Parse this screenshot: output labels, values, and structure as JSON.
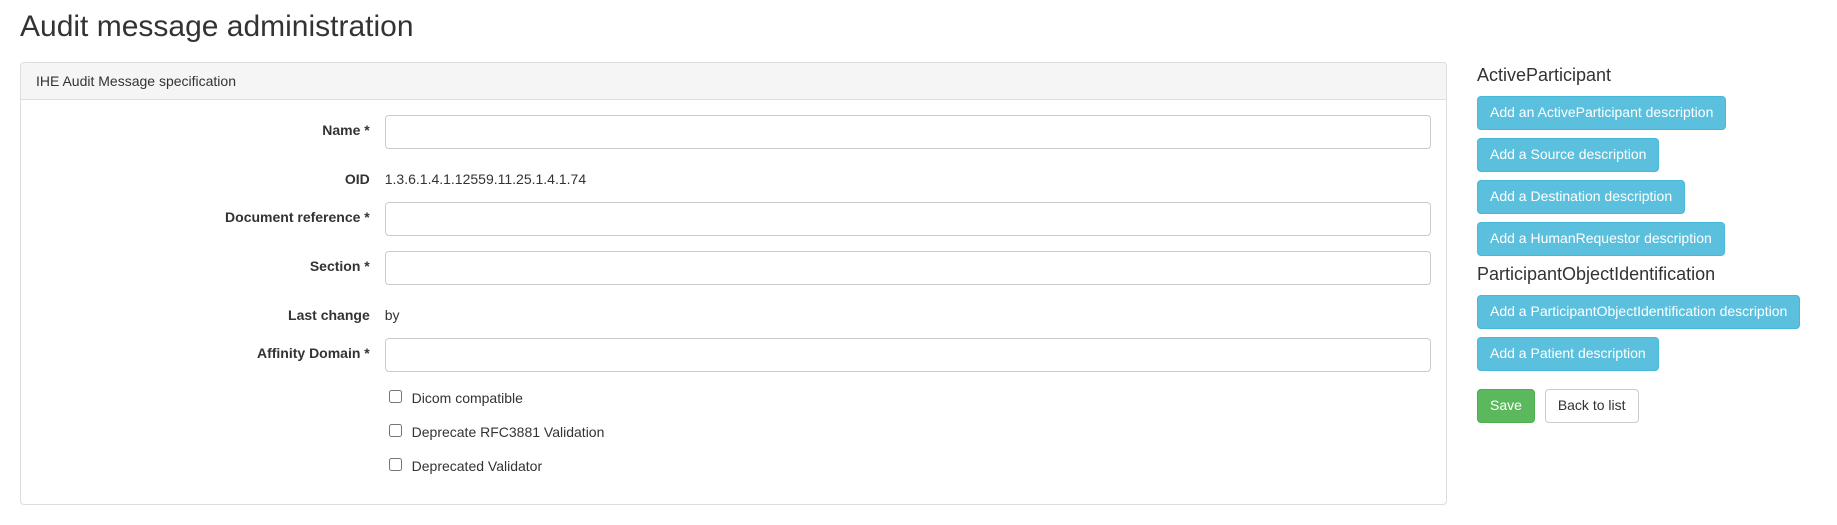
{
  "page_title": "Audit message administration",
  "panel": {
    "heading": "IHE Audit Message specification"
  },
  "form": {
    "labels": {
      "name": "Name *",
      "oid": "OID",
      "doc_ref": "Document reference *",
      "section": "Section *",
      "last_change": "Last change",
      "affinity": "Affinity Domain *"
    },
    "values": {
      "name": "",
      "oid": "1.3.6.1.4.1.12559.11.25.1.4.1.74",
      "doc_ref": "",
      "section": "",
      "last_change": "by",
      "affinity": ""
    },
    "checkboxes": {
      "dicom": {
        "label": "Dicom compatible",
        "checked": false
      },
      "deprecate_rfc": {
        "label": "Deprecate RFC3881 Validation",
        "checked": false
      },
      "deprecated_validator": {
        "label": "Deprecated Validator",
        "checked": false
      }
    }
  },
  "sidebar": {
    "active_participant": {
      "heading": "ActiveParticipant",
      "buttons": {
        "add_ap": "Add an ActiveParticipant description",
        "add_source": "Add a Source description",
        "add_destination": "Add a Destination description",
        "add_human_requestor": "Add a HumanRequestor description"
      }
    },
    "participant_object": {
      "heading": "ParticipantObjectIdentification",
      "buttons": {
        "add_poi": "Add a ParticipantObjectIdentification description",
        "add_patient": "Add a Patient description"
      }
    },
    "actions": {
      "save": "Save",
      "back": "Back to list"
    }
  }
}
